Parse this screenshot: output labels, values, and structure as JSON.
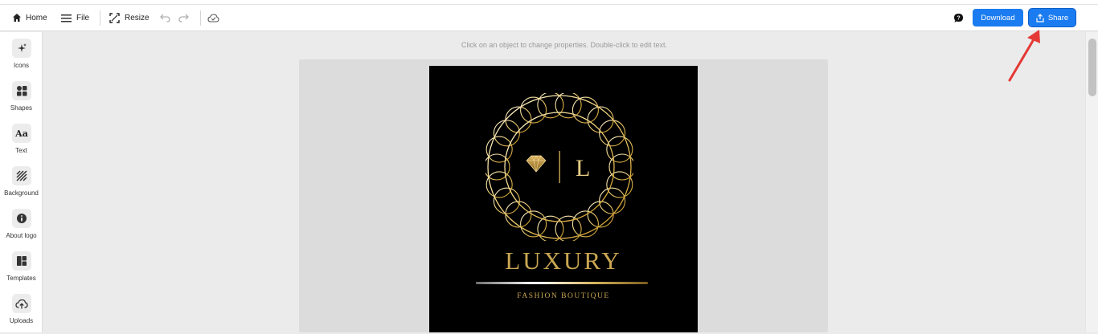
{
  "toolbar": {
    "home_label": "Home",
    "file_label": "File",
    "resize_label": "Resize",
    "download_label": "Download",
    "share_label": "Share"
  },
  "sidebar": {
    "items": [
      {
        "label": "Icons",
        "icon": "sparkle-icon"
      },
      {
        "label": "Shapes",
        "icon": "shapes-icon"
      },
      {
        "label": "Text",
        "icon": "text-aa-icon"
      },
      {
        "label": "Background",
        "icon": "background-pattern-icon"
      },
      {
        "label": "About logo",
        "icon": "info-icon"
      },
      {
        "label": "Templates",
        "icon": "templates-grid-icon"
      },
      {
        "label": "Uploads",
        "icon": "cloud-upload-icon"
      }
    ]
  },
  "workspace": {
    "hint": "Click on an object to change properties. Double-click to edit text."
  },
  "logo": {
    "monogram": "L",
    "brand": "LUXURY",
    "tagline": "FASHION BOUTIQUE"
  },
  "colors": {
    "accent": "#1a7cf0",
    "gold": "#c9a651",
    "annotation_arrow": "#e53935"
  }
}
